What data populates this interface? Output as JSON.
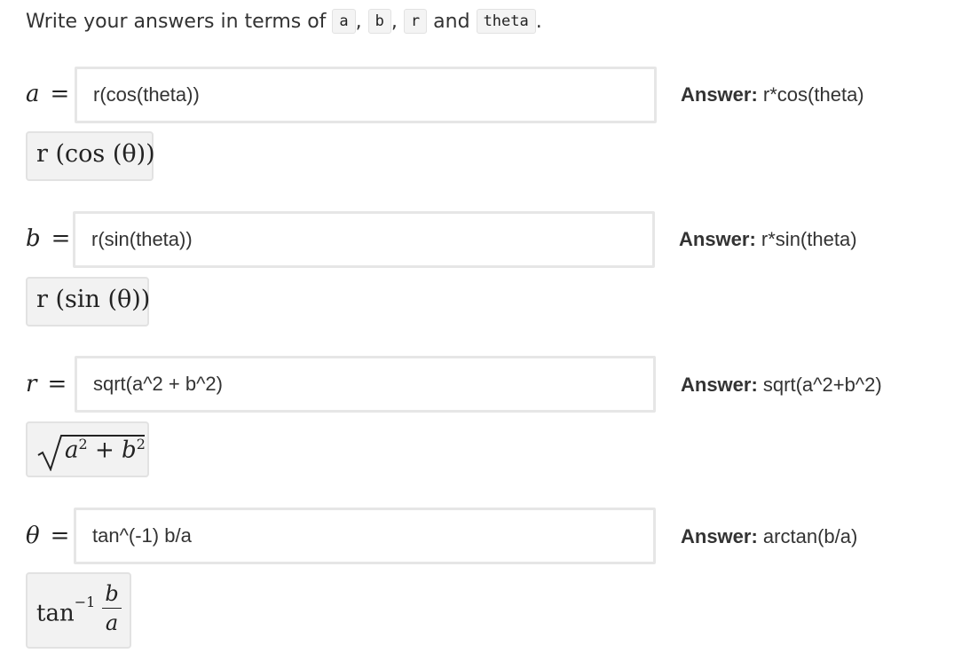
{
  "instructions": {
    "prefix": "Write your answers in terms of",
    "var_a": "a",
    "var_b": "b",
    "var_r": "r",
    "and_text": "and",
    "var_theta": "theta",
    "comma": ",",
    "period": "."
  },
  "rows": [
    {
      "label": "a",
      "equals": "=",
      "input_value": "r(cos(theta))",
      "answer_label": "Answer:",
      "answer_value": "r*cos(theta)",
      "preview_text": "r (cos (θ))"
    },
    {
      "label": "b",
      "equals": "=",
      "input_value": "r(sin(theta))",
      "answer_label": "Answer:",
      "answer_value": "r*sin(theta)",
      "preview_text": "r (sin (θ))"
    },
    {
      "label": "r",
      "equals": "=",
      "input_value": "sqrt(a^2 + b^2)",
      "answer_label": "Answer:",
      "answer_value": "sqrt(a^2+b^2)",
      "preview_radicand_a": "a",
      "preview_radicand_b": "b",
      "preview_exp": "2",
      "preview_plus": "+"
    },
    {
      "label": "θ",
      "equals": "=",
      "input_value": "tan^(-1) b/a",
      "answer_label": "Answer:",
      "answer_value": "arctan(b/a)",
      "preview_func": "tan",
      "preview_exp": "−1",
      "preview_num": "b",
      "preview_den": "a"
    }
  ]
}
